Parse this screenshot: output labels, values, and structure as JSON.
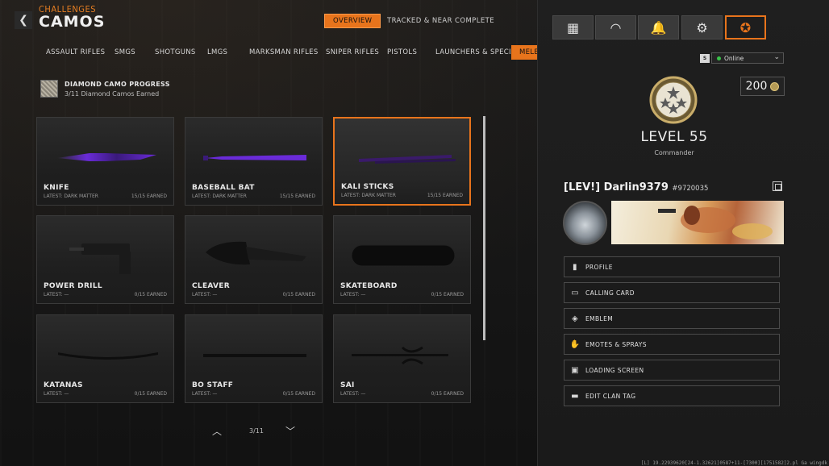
{
  "header": {
    "breadcrumb": "CHALLENGES",
    "title": "CAMOS",
    "back_glyph": "❮",
    "tabs": [
      {
        "label": "OVERVIEW",
        "active": true
      },
      {
        "label": "TRACKED & NEAR COMPLETE",
        "active": false
      }
    ]
  },
  "categories": [
    {
      "label": "ASSAULT RIFLES",
      "active": false
    },
    {
      "label": "SMGS",
      "active": false
    },
    {
      "label": "SHOTGUNS",
      "active": false
    },
    {
      "label": "LMGS",
      "active": false
    },
    {
      "label": "MARKSMAN RIFLES",
      "active": false
    },
    {
      "label": "SNIPER RIFLES",
      "active": false
    },
    {
      "label": "PISTOLS",
      "active": false
    },
    {
      "label": "LAUNCHERS & SPECIALS",
      "active": false
    },
    {
      "label": "MELEE",
      "active": true
    }
  ],
  "progress": {
    "title": "DIAMOND CAMO PROGRESS",
    "subtitle": "3/11 Diamond Camos Earned"
  },
  "weapons": [
    {
      "name": "KNIFE",
      "latest": "LATEST: DARK MATTER",
      "earned": "15/15 EARNED",
      "selected": false,
      "camo": "dark-matter",
      "shape": "knife"
    },
    {
      "name": "BASEBALL BAT",
      "latest": "LATEST: DARK MATTER",
      "earned": "15/15 EARNED",
      "selected": false,
      "camo": "dark-matter",
      "shape": "bat"
    },
    {
      "name": "KALI STICKS",
      "latest": "LATEST: DARK MATTER",
      "earned": "15/15 EARNED",
      "selected": true,
      "camo": "dark-matter",
      "shape": "sticks"
    },
    {
      "name": "POWER DRILL",
      "latest": "LATEST: —",
      "earned": "0/15 EARNED",
      "selected": false,
      "camo": "none",
      "shape": "drill"
    },
    {
      "name": "CLEAVER",
      "latest": "LATEST: —",
      "earned": "0/15 EARNED",
      "selected": false,
      "camo": "none",
      "shape": "cleaver"
    },
    {
      "name": "SKATEBOARD",
      "latest": "LATEST: —",
      "earned": "0/15 EARNED",
      "selected": false,
      "camo": "none",
      "shape": "skateboard"
    },
    {
      "name": "KATANAS",
      "latest": "LATEST: —",
      "earned": "0/15 EARNED",
      "selected": false,
      "camo": "none",
      "shape": "katana"
    },
    {
      "name": "BO STAFF",
      "latest": "LATEST: —",
      "earned": "0/15 EARNED",
      "selected": false,
      "camo": "none",
      "shape": "staff"
    },
    {
      "name": "SAI",
      "latest": "LATEST: —",
      "earned": "0/15 EARNED",
      "selected": false,
      "camo": "none",
      "shape": "sai"
    }
  ],
  "pager": {
    "text": "3/11",
    "up_glyph": "︿",
    "down_glyph": "﹀"
  },
  "panel": {
    "nav": [
      {
        "icon": "grid-icon",
        "glyph": "▦",
        "active": false
      },
      {
        "icon": "barracks-icon",
        "glyph": "◠",
        "active": false
      },
      {
        "icon": "bell-icon",
        "glyph": "🔔",
        "active": false
      },
      {
        "icon": "gear-icon",
        "glyph": "⚙",
        "active": false
      },
      {
        "icon": "prestige-icon",
        "glyph": "✪",
        "active": true
      }
    ],
    "status_badge": "S",
    "status": "Online",
    "status_chevron": "⌄",
    "cod_points": "200",
    "level": "LEVEL 55",
    "rank": "Commander",
    "gamertag": "[LEV!] Darlin9379",
    "gamer_id": "#9720035",
    "menu": [
      {
        "label": "PROFILE",
        "icon": "profile-icon",
        "glyph": "▮"
      },
      {
        "label": "CALLING CARD",
        "icon": "calling-card-icon",
        "glyph": "▭"
      },
      {
        "label": "EMBLEM",
        "icon": "emblem-icon",
        "glyph": "◈"
      },
      {
        "label": "EMOTES & SPRAYS",
        "icon": "emote-icon",
        "glyph": "✋"
      },
      {
        "label": "LOADING SCREEN",
        "icon": "loading-screen-icon",
        "glyph": "▣"
      },
      {
        "label": "EDIT CLAN TAG",
        "icon": "clan-tag-icon",
        "glyph": "▬"
      }
    ]
  },
  "footer_code": "[L] 19.22939620[24-1.32621]0587+11-[7300][1751582]2.pl Ga wingdk",
  "colors": {
    "accent": "#e8741c",
    "online": "#3ac24a",
    "dark_matter": "#6a2bd9"
  }
}
